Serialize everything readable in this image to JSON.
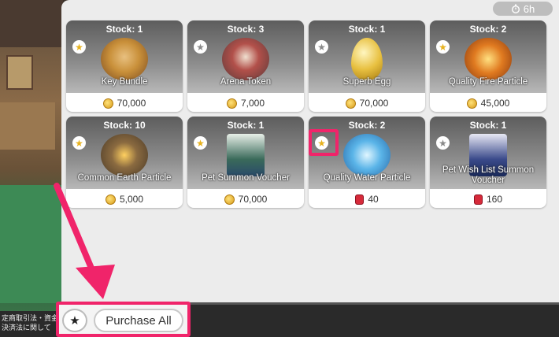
{
  "timer": {
    "text": "6h",
    "icon": "stopwatch-icon"
  },
  "items": [
    {
      "stock": "Stock: 1",
      "name": "Key Bundle",
      "price": "70,000",
      "currency": "coin",
      "starred": true,
      "art_color": "#c9903a"
    },
    {
      "stock": "Stock: 3",
      "name": "Arena Token",
      "price": "7,000",
      "currency": "coin",
      "starred": false,
      "art_color": "#b2504a"
    },
    {
      "stock": "Stock: 1",
      "name": "Superb Egg",
      "price": "70,000",
      "currency": "coin",
      "starred": false,
      "art_color": "#e8c040"
    },
    {
      "stock": "Stock: 2",
      "name": "Quality Fire Particle",
      "price": "45,000",
      "currency": "coin",
      "starred": true,
      "art_color": "#e07a20"
    },
    {
      "stock": "Stock: 10",
      "name": "Common Earth Particle",
      "price": "5,000",
      "currency": "coin",
      "starred": true,
      "art_color": "#8a6a40"
    },
    {
      "stock": "Stock: 1",
      "name": "Pet Summon Voucher",
      "price": "70,000",
      "currency": "coin",
      "starred": true,
      "art_color": "#3a6a5a"
    },
    {
      "stock": "Stock: 2",
      "name": "Quality Water Particle",
      "price": "40",
      "currency": "gem",
      "starred": true,
      "art_color": "#5ab4e8"
    },
    {
      "stock": "Stock: 1",
      "name": "Pet Wish List Summon Voucher",
      "price": "160",
      "currency": "gem",
      "starred": false,
      "art_color": "#3a4a8a"
    }
  ],
  "bottom": {
    "purchase_all_label": "Purchase All",
    "auto_icon": "star-check-icon"
  },
  "notice": {
    "text": "定商取引法・資金決済法に関して"
  },
  "colors": {
    "highlight": "#f0246a",
    "star": "#e7b21e",
    "gem": "#d62a3a"
  }
}
